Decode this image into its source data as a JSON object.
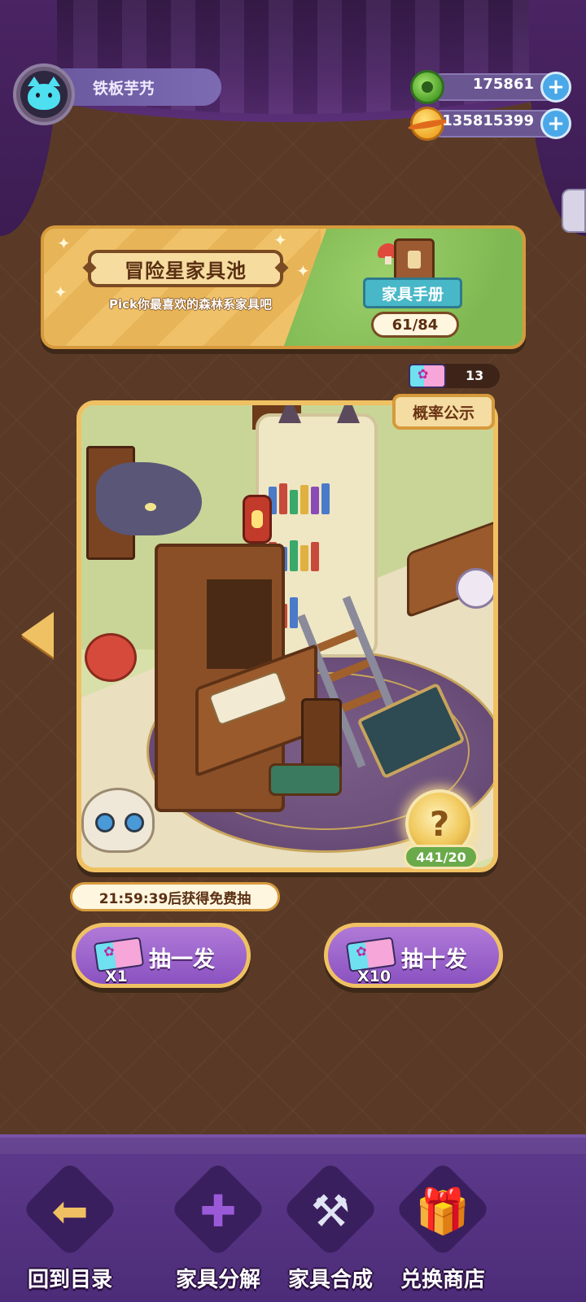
{
  "profile": {
    "username": "铁板芋艿"
  },
  "currencies": [
    {
      "value": "175861",
      "icon": "green-gem-icon"
    },
    {
      "value": "135815399",
      "icon": "gold-planet-icon"
    }
  ],
  "banner": {
    "title": "冒险星家具池",
    "subtitle": "Pick你最喜欢的森林系家具吧",
    "handbook_label": "家具手册",
    "handbook_count": "61/84"
  },
  "tickets": {
    "count": "13"
  },
  "card": {
    "probability_label": "概率公示",
    "mystery_symbol": "?",
    "progress": "441/20"
  },
  "timer": {
    "text": "21:59:39后获得免费抽"
  },
  "draw": {
    "single_label": "抽一发",
    "single_mult": "X1",
    "ten_label": "抽十发",
    "ten_mult": "X10"
  },
  "bottom_nav": {
    "items": [
      {
        "label": "回到目录",
        "icon": "back-to-menu-icon"
      },
      {
        "label": "家具分解",
        "icon": "decompose-puzzle-icon"
      },
      {
        "label": "家具合成",
        "icon": "hammer-icon"
      },
      {
        "label": "兑换商店",
        "icon": "gift-icon"
      }
    ]
  },
  "colors": {
    "background": "#5a3a26",
    "gold_border": "#f0c163",
    "purple_button": "#8a52c0",
    "nav_purple": "#5e3a8c"
  }
}
